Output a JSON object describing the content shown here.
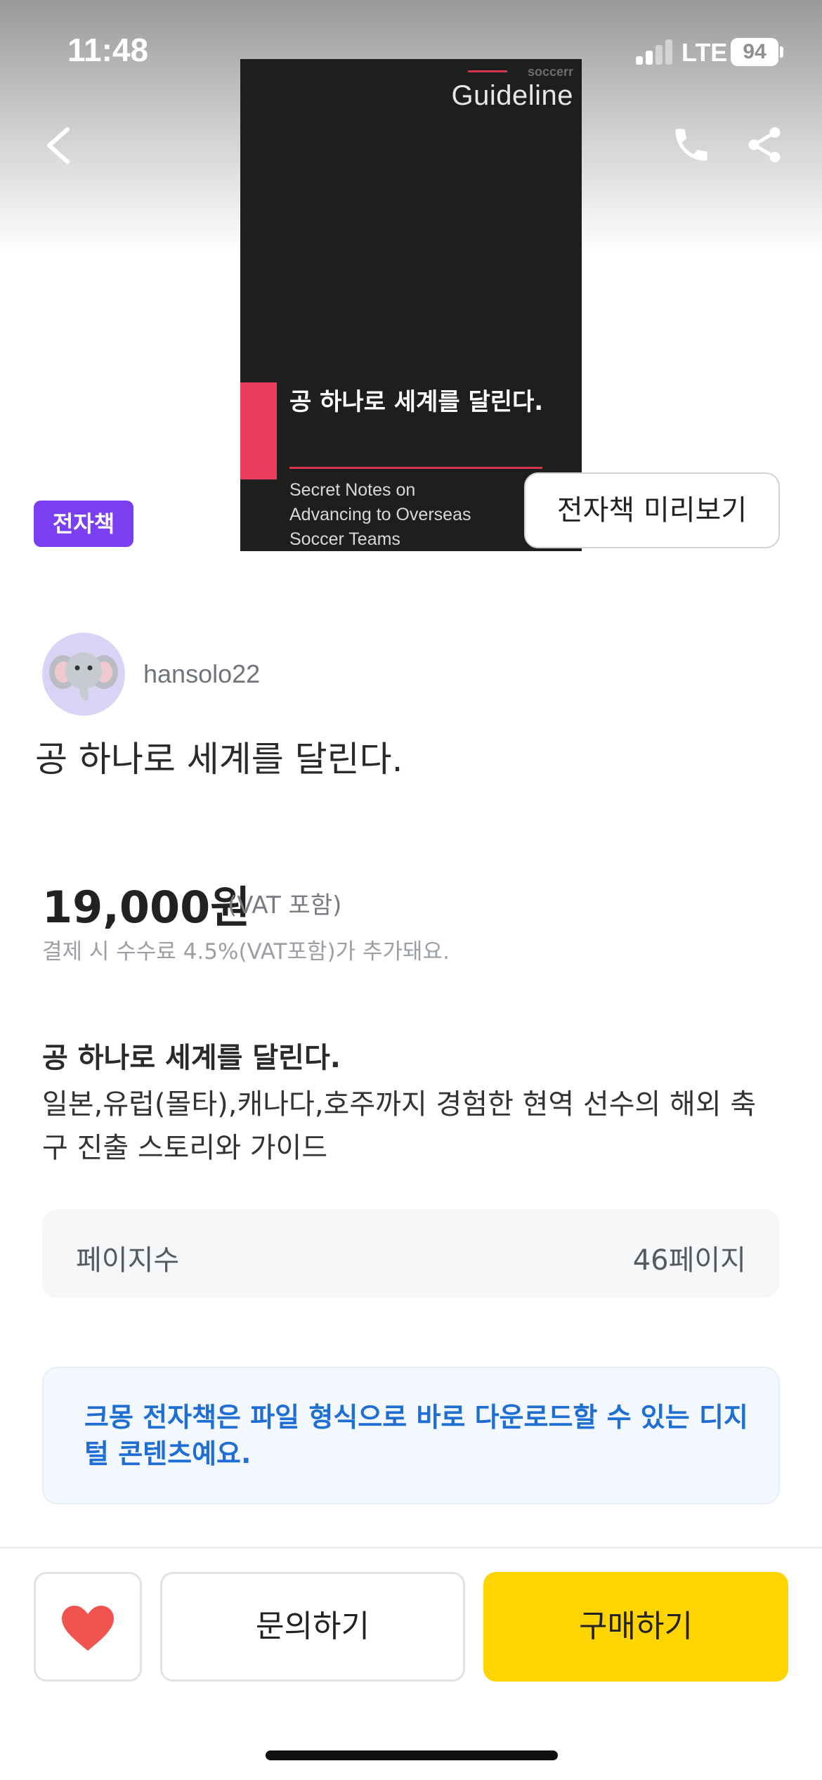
{
  "status_bar": {
    "time": "11:48",
    "network": "LTE",
    "battery": "94"
  },
  "nav": {
    "back_icon": "chevron-left-icon",
    "call_icon": "phone-icon",
    "share_icon": "share-icon"
  },
  "cover": {
    "brand": "soccerr",
    "title_en": "Guideline",
    "title_ko": "공 하나로 세계를 달린다.",
    "subtitle": "Secret Notes on Advancing to Overseas Soccer Teams",
    "accent_color": "#ec3c60",
    "background_color": "#1c1f1e"
  },
  "badge": {
    "label": "전자책",
    "color": "#7a3ff0"
  },
  "preview_button": {
    "label": "전자책 미리보기"
  },
  "seller": {
    "name": "hansolo22",
    "avatar_icon": "elephant-icon"
  },
  "product": {
    "title": "공 하나로 세계를 달린다."
  },
  "price": {
    "amount": "19,000원",
    "vat": "(VAT 포함)",
    "fee_note": "결제 시 수수료 4.5%(VAT포함)가 추가돼요."
  },
  "description": {
    "title": "공 하나로 세계를 달린다.",
    "body": "일본,유럽(몰타),캐나다,호주까지 경험한 현역 선수의 해외 축구 진출 스토리와 가이드"
  },
  "details": {
    "pages_label": "페이지수",
    "pages_value": "46페이지"
  },
  "info": {
    "text": "크몽 전자책은 파일 형식으로 바로 다운로드할 수 있는 디지털 콘텐츠예요."
  },
  "bottom_bar": {
    "like_icon": "heart-icon",
    "inquiry_label": "문의하기",
    "buy_label": "구매하기",
    "buy_color": "#ffd400",
    "heart_color": "#f0544f"
  }
}
